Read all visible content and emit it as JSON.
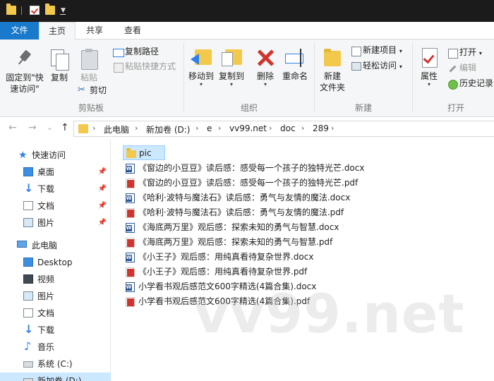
{
  "window": {
    "qat_icons": [
      "folder-icon",
      "properties-check-icon",
      "new-folder-icon",
      "customize-dropdown-icon"
    ]
  },
  "ribbon_tabs": {
    "file": "文件",
    "home": "主页",
    "share": "共享",
    "view": "查看"
  },
  "ribbon": {
    "clipboard": {
      "pin_label": "固定到\"快\n速访问\"",
      "copy_label": "复制",
      "paste_label": "粘贴",
      "copy_path_label": "复制路径",
      "paste_shortcut_label": "粘贴快捷方式",
      "cut_label": "剪切",
      "group_label": "剪贴板"
    },
    "organize": {
      "move_to_label": "移动到",
      "copy_to_label": "复制到",
      "delete_label": "删除",
      "rename_label": "重命名",
      "group_label": "组织"
    },
    "new": {
      "new_folder_label": "新建\n文件夹",
      "new_item_label": "新建项目",
      "easy_access_label": "轻松访问",
      "group_label": "新建"
    },
    "open": {
      "properties_label": "属性",
      "open_label": "打开",
      "edit_label": "编辑",
      "history_label": "历史记录",
      "group_label": "打开"
    }
  },
  "address_bar": {
    "back": "←",
    "forward": "→",
    "recent": "⌄",
    "up": "↑",
    "path": [
      "此电脑",
      "新加卷 (D:)",
      "e",
      "vv99.net",
      "doc",
      "289"
    ]
  },
  "sidebar": {
    "quick_access": "快速访问",
    "quick_items": [
      {
        "label": "桌面"
      },
      {
        "label": "下载"
      },
      {
        "label": "文档"
      },
      {
        "label": "图片"
      }
    ],
    "this_pc": "此电脑",
    "pc_items": [
      {
        "label": "Desktop"
      },
      {
        "label": "视频"
      },
      {
        "label": "图片"
      },
      {
        "label": "文档"
      },
      {
        "label": "下载"
      },
      {
        "label": "音乐"
      },
      {
        "label": "系统 (C:)"
      },
      {
        "label": "新加卷 (D:)"
      }
    ]
  },
  "files": [
    {
      "name": "pic",
      "type": "folder"
    },
    {
      "name": "《窗边的小豆豆》读后感：感受每一个孩子的独特光芒.docx",
      "type": "docx"
    },
    {
      "name": "《窗边的小豆豆》读后感：感受每一个孩子的独特光芒.pdf",
      "type": "pdf"
    },
    {
      "name": "《哈利·波特与魔法石》读后感：勇气与友情的魔法.docx",
      "type": "docx"
    },
    {
      "name": "《哈利·波特与魔法石》读后感：勇气与友情的魔法.pdf",
      "type": "pdf"
    },
    {
      "name": "《海底两万里》观后感：探索未知的勇气与智慧.docx",
      "type": "docx"
    },
    {
      "name": "《海底两万里》观后感：探索未知的勇气与智慧.pdf",
      "type": "pdf"
    },
    {
      "name": "《小王子》观后感：用纯真看待复杂世界.docx",
      "type": "docx"
    },
    {
      "name": "《小王子》观后感：用纯真看待复杂世界.pdf",
      "type": "pdf"
    },
    {
      "name": "小学看书观后感范文600字精选(4篇合集).docx",
      "type": "docx"
    },
    {
      "name": "小学看书观后感范文600字精选(4篇合集).pdf",
      "type": "pdf"
    }
  ],
  "watermark": "vv99.net",
  "colors": {
    "file_tab": "#1979ca",
    "selection": "#cce8ff",
    "folder": "#f2c94c",
    "pdf": "#d0342c",
    "docx": "#2b579a"
  }
}
